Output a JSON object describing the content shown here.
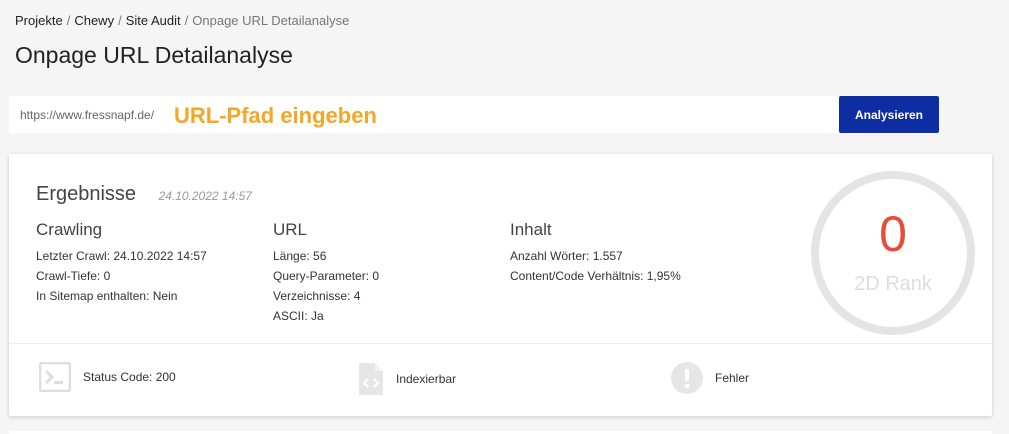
{
  "breadcrumb": {
    "items": [
      "Projekte",
      "Chewy",
      "Site Audit"
    ],
    "current": "Onpage URL Detailanalyse",
    "separator": "/"
  },
  "page_title": "Onpage URL Detailanalyse",
  "url_bar": {
    "prefix": "https://www.fressnapf.de/",
    "placeholder": "URL-Pfad eingeben",
    "button_label": "Analysieren"
  },
  "results": {
    "title": "Ergebnisse",
    "date": "24.10.2022 14:57",
    "columns": [
      {
        "title": "Crawling",
        "rows": [
          "Letzter Crawl: 24.10.2022 14:57",
          "Crawl-Tiefe: 0",
          "In Sitemap enthalten: Nein"
        ]
      },
      {
        "title": "URL",
        "rows": [
          "Länge: 56",
          "Query-Parameter: 0",
          "Verzeichnisse: 4",
          "ASCII: Ja"
        ]
      },
      {
        "title": "Inhalt",
        "rows": [
          "Anzahl Wörter: 1.557",
          "Content/Code Verhältnis: 1,95%"
        ]
      }
    ],
    "rank": {
      "value": "0",
      "label": "2D Rank"
    },
    "status_items": [
      {
        "icon": "terminal-icon",
        "label": "Status Code: 200"
      },
      {
        "icon": "code-file-icon",
        "label": "Indexierbar"
      },
      {
        "icon": "exclamation-circle-icon",
        "label": "Fehler"
      }
    ]
  },
  "colors": {
    "accent_button": "#0d2da2",
    "placeholder": "#f5a623",
    "rank_value": "#e74c3c",
    "icon_gray": "#dedede"
  }
}
